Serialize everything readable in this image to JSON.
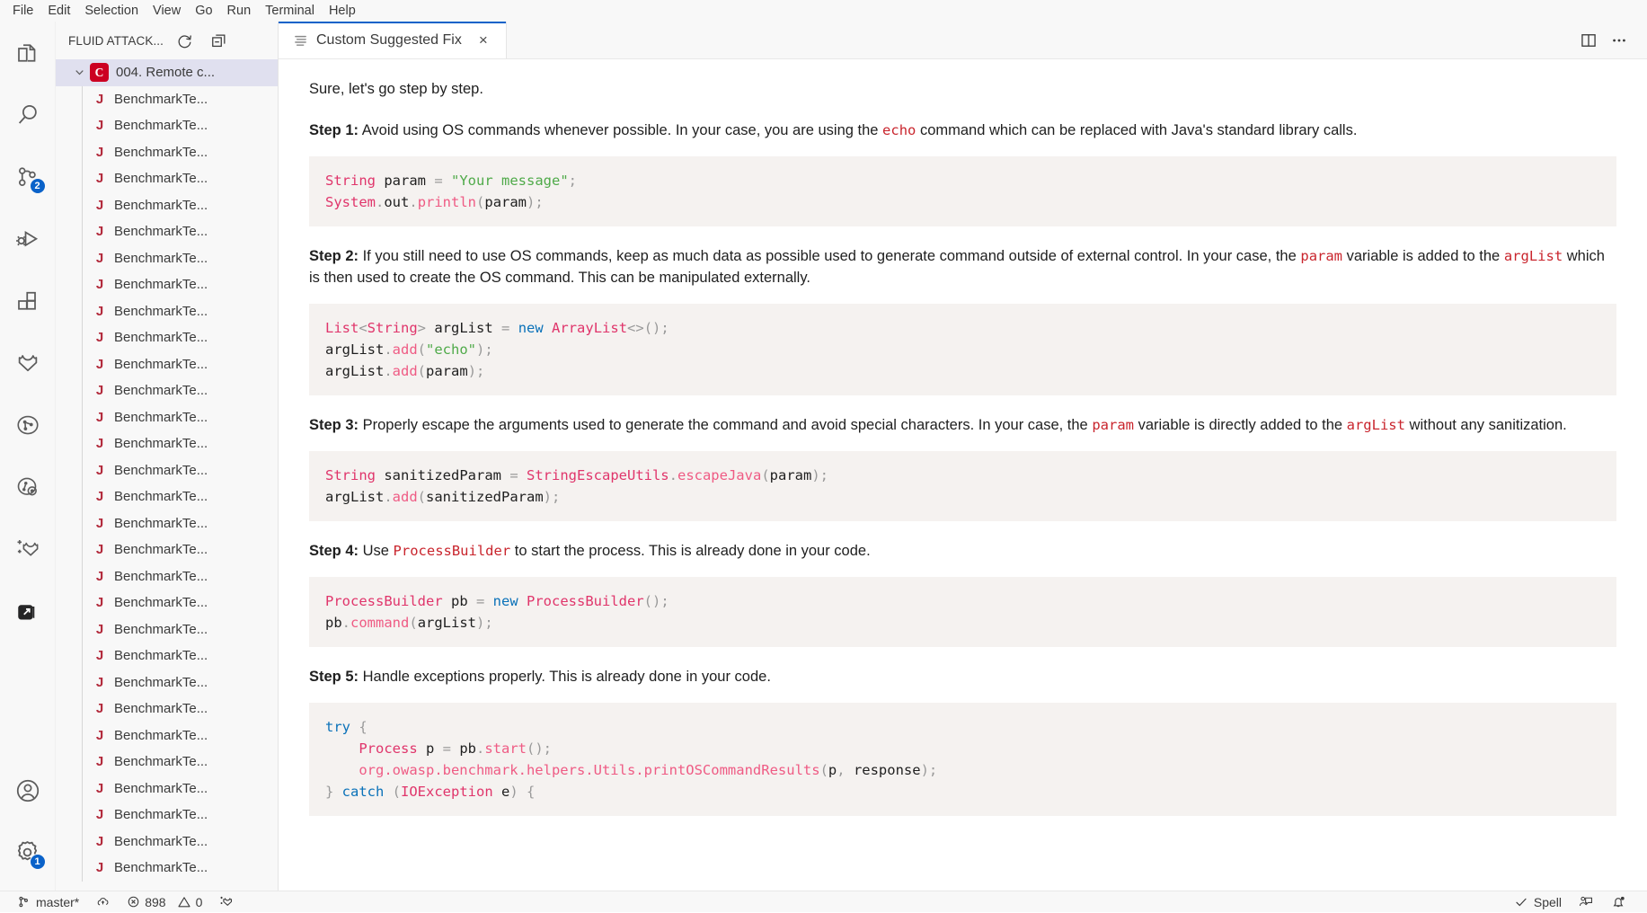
{
  "menubar": {
    "items": [
      {
        "label": "File"
      },
      {
        "label": "Edit"
      },
      {
        "label": "Selection"
      },
      {
        "label": "View"
      },
      {
        "label": "Go"
      },
      {
        "label": "Run"
      },
      {
        "label": "Terminal"
      },
      {
        "label": "Help"
      }
    ]
  },
  "activitybar": {
    "items": [
      {
        "name": "explorer",
        "icon": "files-icon",
        "badge": null
      },
      {
        "name": "search",
        "icon": "search-icon",
        "badge": null
      },
      {
        "name": "source-control",
        "icon": "source-control-icon",
        "badge": "2"
      },
      {
        "name": "run-and-debug",
        "icon": "run-debug-icon",
        "badge": null
      },
      {
        "name": "extensions",
        "icon": "extensions-icon",
        "badge": null
      },
      {
        "name": "fluid-attacks",
        "icon": "fluid-attacks-logo-icon",
        "badge": null
      },
      {
        "name": "vulnerabilities",
        "icon": "vulnerability-graph-icon",
        "badge": null
      },
      {
        "name": "scan",
        "icon": "scan-target-icon",
        "badge": null
      },
      {
        "name": "add-fluid",
        "icon": "add-fluid-icon",
        "badge": null
      },
      {
        "name": "remote-explorer",
        "icon": "remote-window-icon",
        "badge": null
      }
    ],
    "bottom_items": [
      {
        "name": "accounts",
        "icon": "account-icon",
        "badge": null
      },
      {
        "name": "manage",
        "icon": "gear-icon",
        "badge": "1"
      }
    ]
  },
  "sidebar": {
    "title": "FLUID ATTACK...",
    "actions": [
      {
        "name": "refresh-button",
        "icon": "refresh-icon"
      },
      {
        "name": "collapse-all-button",
        "icon": "collapse-all-icon"
      }
    ],
    "tree": {
      "root": {
        "label": "004. Remote c...",
        "badge": "C",
        "expanded": true
      },
      "children": [
        {
          "label": "BenchmarkTe...",
          "icon": "java-file-icon"
        },
        {
          "label": "BenchmarkTe...",
          "icon": "java-file-icon"
        },
        {
          "label": "BenchmarkTe...",
          "icon": "java-file-icon"
        },
        {
          "label": "BenchmarkTe...",
          "icon": "java-file-icon"
        },
        {
          "label": "BenchmarkTe...",
          "icon": "java-file-icon"
        },
        {
          "label": "BenchmarkTe...",
          "icon": "java-file-icon"
        },
        {
          "label": "BenchmarkTe...",
          "icon": "java-file-icon"
        },
        {
          "label": "BenchmarkTe...",
          "icon": "java-file-icon"
        },
        {
          "label": "BenchmarkTe...",
          "icon": "java-file-icon"
        },
        {
          "label": "BenchmarkTe...",
          "icon": "java-file-icon"
        },
        {
          "label": "BenchmarkTe...",
          "icon": "java-file-icon"
        },
        {
          "label": "BenchmarkTe...",
          "icon": "java-file-icon"
        },
        {
          "label": "BenchmarkTe...",
          "icon": "java-file-icon"
        },
        {
          "label": "BenchmarkTe...",
          "icon": "java-file-icon"
        },
        {
          "label": "BenchmarkTe...",
          "icon": "java-file-icon"
        },
        {
          "label": "BenchmarkTe...",
          "icon": "java-file-icon"
        },
        {
          "label": "BenchmarkTe...",
          "icon": "java-file-icon"
        },
        {
          "label": "BenchmarkTe...",
          "icon": "java-file-icon"
        },
        {
          "label": "BenchmarkTe...",
          "icon": "java-file-icon"
        },
        {
          "label": "BenchmarkTe...",
          "icon": "java-file-icon"
        },
        {
          "label": "BenchmarkTe...",
          "icon": "java-file-icon"
        },
        {
          "label": "BenchmarkTe...",
          "icon": "java-file-icon"
        },
        {
          "label": "BenchmarkTe...",
          "icon": "java-file-icon"
        },
        {
          "label": "BenchmarkTe...",
          "icon": "java-file-icon"
        },
        {
          "label": "BenchmarkTe...",
          "icon": "java-file-icon"
        },
        {
          "label": "BenchmarkTe...",
          "icon": "java-file-icon"
        },
        {
          "label": "BenchmarkTe...",
          "icon": "java-file-icon"
        },
        {
          "label": "BenchmarkTe...",
          "icon": "java-file-icon"
        },
        {
          "label": "BenchmarkTe...",
          "icon": "java-file-icon"
        },
        {
          "label": "BenchmarkTe...",
          "icon": "java-file-icon"
        }
      ]
    }
  },
  "editor": {
    "tabs": [
      {
        "label": "Custom Suggested Fix",
        "icon": "preview-icon",
        "active": true,
        "close_label": "×"
      }
    ],
    "actions": [
      {
        "name": "split-editor-button",
        "icon": "split-editor-icon"
      },
      {
        "name": "more-actions-button",
        "icon": "ellipsis-icon"
      }
    ]
  },
  "content": {
    "intro": "Sure, let's go step by step.",
    "steps": [
      {
        "label": "Step 1:",
        "parts": [
          {
            "t": "text",
            "v": " Avoid using OS commands whenever possible. In your case, you are using the "
          },
          {
            "t": "code",
            "v": "echo"
          },
          {
            "t": "text",
            "v": " command which can be replaced with Java's standard library calls."
          }
        ],
        "code": [
          [
            {
              "c": "tok-type",
              "v": "String"
            },
            {
              "c": "tok-plain",
              "v": " param "
            },
            {
              "c": "tok-punc",
              "v": "="
            },
            {
              "c": "tok-plain",
              "v": " "
            },
            {
              "c": "tok-str",
              "v": "\"Your message\""
            },
            {
              "c": "tok-punc",
              "v": ";"
            }
          ],
          [
            {
              "c": "tok-type",
              "v": "System"
            },
            {
              "c": "tok-punc",
              "v": "."
            },
            {
              "c": "tok-plain",
              "v": "out"
            },
            {
              "c": "tok-punc",
              "v": "."
            },
            {
              "c": "tok-fn",
              "v": "println"
            },
            {
              "c": "tok-punc",
              "v": "("
            },
            {
              "c": "tok-plain",
              "v": "param"
            },
            {
              "c": "tok-punc",
              "v": ");"
            }
          ]
        ]
      },
      {
        "label": "Step 2:",
        "parts": [
          {
            "t": "text",
            "v": " If you still need to use OS commands, keep as much data as possible used to generate command outside of external control. In your case, the "
          },
          {
            "t": "code",
            "v": "param"
          },
          {
            "t": "text",
            "v": " variable is added to the "
          },
          {
            "t": "code",
            "v": "argList"
          },
          {
            "t": "text",
            "v": " which is then used to create the OS command. This can be manipulated externally."
          }
        ],
        "code": [
          [
            {
              "c": "tok-type",
              "v": "List"
            },
            {
              "c": "tok-punc",
              "v": "<"
            },
            {
              "c": "tok-type",
              "v": "String"
            },
            {
              "c": "tok-punc",
              "v": ">"
            },
            {
              "c": "tok-plain",
              "v": " argList "
            },
            {
              "c": "tok-punc",
              "v": "="
            },
            {
              "c": "tok-plain",
              "v": " "
            },
            {
              "c": "tok-kw",
              "v": "new"
            },
            {
              "c": "tok-plain",
              "v": " "
            },
            {
              "c": "tok-type",
              "v": "ArrayList"
            },
            {
              "c": "tok-punc",
              "v": "<>();"
            }
          ],
          [
            {
              "c": "tok-plain",
              "v": "argList"
            },
            {
              "c": "tok-punc",
              "v": "."
            },
            {
              "c": "tok-fn",
              "v": "add"
            },
            {
              "c": "tok-punc",
              "v": "("
            },
            {
              "c": "tok-str",
              "v": "\"echo\""
            },
            {
              "c": "tok-punc",
              "v": ");"
            }
          ],
          [
            {
              "c": "tok-plain",
              "v": "argList"
            },
            {
              "c": "tok-punc",
              "v": "."
            },
            {
              "c": "tok-fn",
              "v": "add"
            },
            {
              "c": "tok-punc",
              "v": "("
            },
            {
              "c": "tok-plain",
              "v": "param"
            },
            {
              "c": "tok-punc",
              "v": ");"
            }
          ]
        ]
      },
      {
        "label": "Step 3:",
        "parts": [
          {
            "t": "text",
            "v": " Properly escape the arguments used to generate the command and avoid special characters. In your case, the "
          },
          {
            "t": "code",
            "v": "param"
          },
          {
            "t": "text",
            "v": " variable is directly added to the "
          },
          {
            "t": "code",
            "v": "argList"
          },
          {
            "t": "text",
            "v": " without any sanitization."
          }
        ],
        "code": [
          [
            {
              "c": "tok-type",
              "v": "String"
            },
            {
              "c": "tok-plain",
              "v": " sanitizedParam "
            },
            {
              "c": "tok-punc",
              "v": "="
            },
            {
              "c": "tok-plain",
              "v": " "
            },
            {
              "c": "tok-type",
              "v": "StringEscapeUtils"
            },
            {
              "c": "tok-punc",
              "v": "."
            },
            {
              "c": "tok-fn",
              "v": "escapeJava"
            },
            {
              "c": "tok-punc",
              "v": "("
            },
            {
              "c": "tok-plain",
              "v": "param"
            },
            {
              "c": "tok-punc",
              "v": ");"
            }
          ],
          [
            {
              "c": "tok-plain",
              "v": "argList"
            },
            {
              "c": "tok-punc",
              "v": "."
            },
            {
              "c": "tok-fn",
              "v": "add"
            },
            {
              "c": "tok-punc",
              "v": "("
            },
            {
              "c": "tok-plain",
              "v": "sanitizedParam"
            },
            {
              "c": "tok-punc",
              "v": ");"
            }
          ]
        ]
      },
      {
        "label": "Step 4:",
        "parts": [
          {
            "t": "text",
            "v": " Use "
          },
          {
            "t": "code",
            "v": "ProcessBuilder"
          },
          {
            "t": "text",
            "v": " to start the process. This is already done in your code."
          }
        ],
        "code": [
          [
            {
              "c": "tok-type",
              "v": "ProcessBuilder"
            },
            {
              "c": "tok-plain",
              "v": " pb "
            },
            {
              "c": "tok-punc",
              "v": "="
            },
            {
              "c": "tok-plain",
              "v": " "
            },
            {
              "c": "tok-kw",
              "v": "new"
            },
            {
              "c": "tok-plain",
              "v": " "
            },
            {
              "c": "tok-type",
              "v": "ProcessBuilder"
            },
            {
              "c": "tok-punc",
              "v": "();"
            }
          ],
          [
            {
              "c": "tok-plain",
              "v": "pb"
            },
            {
              "c": "tok-punc",
              "v": "."
            },
            {
              "c": "tok-fn",
              "v": "command"
            },
            {
              "c": "tok-punc",
              "v": "("
            },
            {
              "c": "tok-plain",
              "v": "argList"
            },
            {
              "c": "tok-punc",
              "v": ");"
            }
          ]
        ]
      },
      {
        "label": "Step 5:",
        "parts": [
          {
            "t": "text",
            "v": " Handle exceptions properly. This is already done in your code."
          }
        ],
        "code": [
          [
            {
              "c": "tok-kw",
              "v": "try"
            },
            {
              "c": "tok-punc",
              "v": " {"
            }
          ],
          [
            {
              "c": "tok-plain",
              "v": "    "
            },
            {
              "c": "tok-type",
              "v": "Process"
            },
            {
              "c": "tok-plain",
              "v": " p "
            },
            {
              "c": "tok-punc",
              "v": "="
            },
            {
              "c": "tok-plain",
              "v": " pb"
            },
            {
              "c": "tok-punc",
              "v": "."
            },
            {
              "c": "tok-fn",
              "v": "start"
            },
            {
              "c": "tok-punc",
              "v": "();"
            }
          ],
          [
            {
              "c": "tok-plain",
              "v": "    "
            },
            {
              "c": "tok-fn",
              "v": "org.owasp.benchmark.helpers.Utils.printOSCommandResults"
            },
            {
              "c": "tok-punc",
              "v": "("
            },
            {
              "c": "tok-plain",
              "v": "p"
            },
            {
              "c": "tok-punc",
              "v": ", "
            },
            {
              "c": "tok-plain",
              "v": "response"
            },
            {
              "c": "tok-punc",
              "v": ");"
            }
          ],
          [
            {
              "c": "tok-punc",
              "v": "} "
            },
            {
              "c": "tok-kw",
              "v": "catch"
            },
            {
              "c": "tok-punc",
              "v": " ("
            },
            {
              "c": "tok-type",
              "v": "IOException"
            },
            {
              "c": "tok-plain",
              "v": " e"
            },
            {
              "c": "tok-punc",
              "v": ") {"
            }
          ]
        ]
      }
    ]
  },
  "statusbar": {
    "left": [
      {
        "name": "branch",
        "icon": "source-control-icon",
        "label": "master*"
      },
      {
        "name": "sync",
        "icon": "cloud-sync-icon",
        "label": ""
      },
      {
        "name": "problems-errors",
        "icon": "error-icon",
        "label": "898"
      },
      {
        "name": "problems-warnings",
        "icon": "warning-icon",
        "label": "0"
      },
      {
        "name": "fluid-attacks-status",
        "icon": "add-fluid-icon",
        "label": ""
      }
    ],
    "right": [
      {
        "name": "spell-checker",
        "icon": "check-icon",
        "label": "Spell"
      },
      {
        "name": "feedback",
        "icon": "feedback-icon",
        "label": ""
      },
      {
        "name": "notifications",
        "icon": "bell-dot-icon",
        "label": ""
      }
    ]
  },
  "colors": {
    "accent": "#0a62c9",
    "badge_red": "#cc0022",
    "inline_code": "#c9252d",
    "code_bg": "#f5f2f0",
    "chrome_bg": "#f8f8f8"
  }
}
